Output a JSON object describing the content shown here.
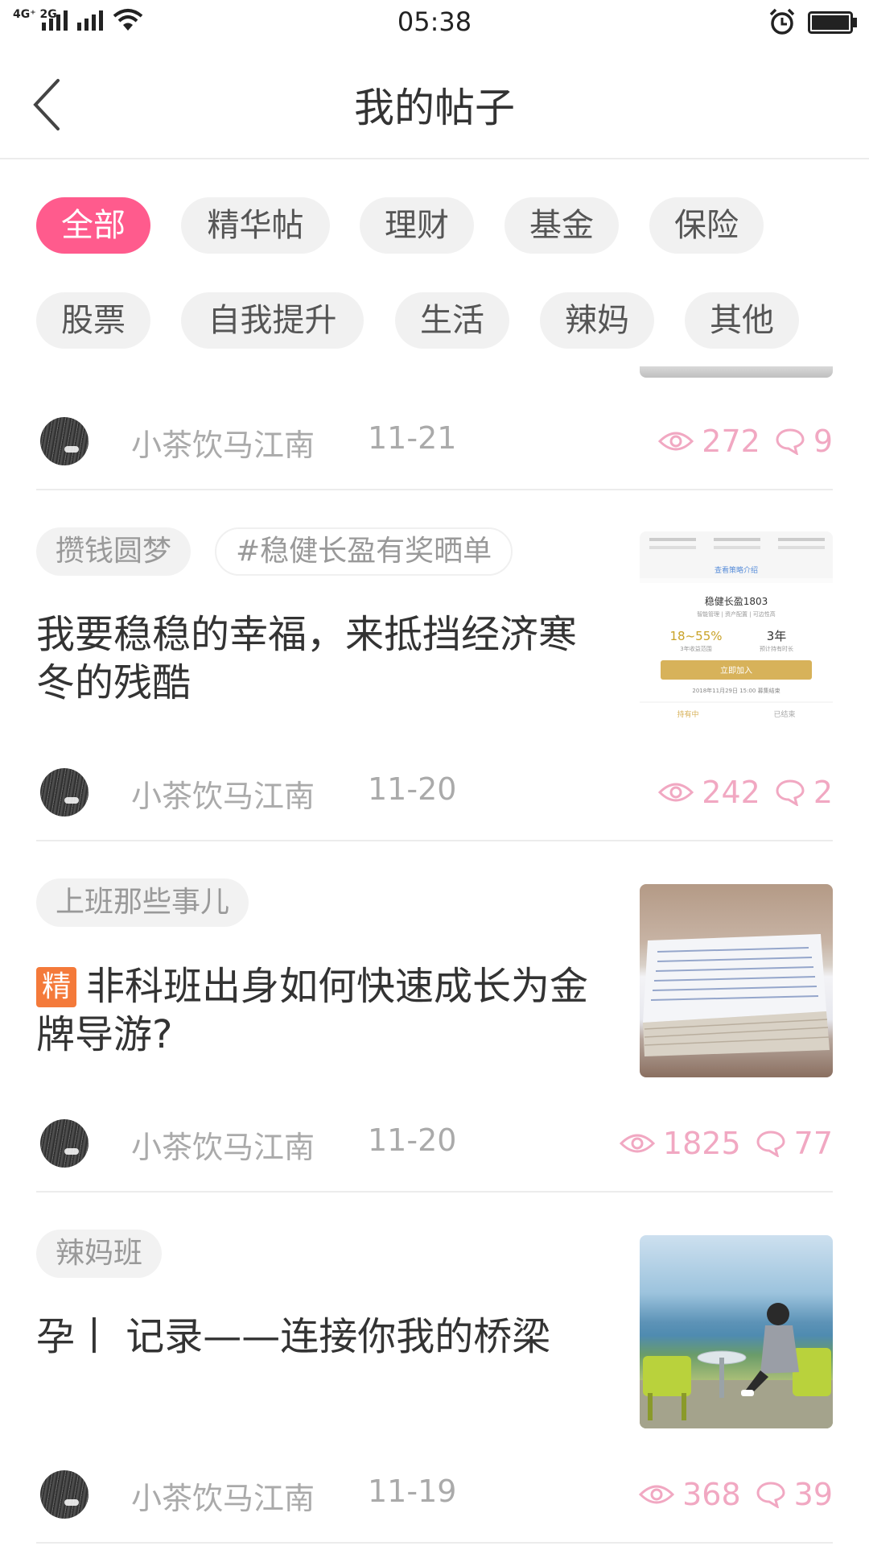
{
  "status_bar": {
    "network": "4G⁺ 2G",
    "time": "05:38"
  },
  "header": {
    "title": "我的帖子"
  },
  "filters": [
    "全部",
    "精华帖",
    "理财",
    "基金",
    "保险",
    "股票",
    "自我提升",
    "生活",
    "辣妈",
    "其他"
  ],
  "active_filter": "全部",
  "colors": {
    "accent_pink": "#ff5b8d",
    "stats_pink": "#f1a8c2",
    "featured_badge": "#f47a3a"
  },
  "posts": [
    {
      "author": "小茶饮马江南",
      "date": "11-21",
      "views": "272",
      "comments": "9"
    },
    {
      "tags": [
        "攒钱圆梦",
        "#稳健长盈有奖晒单"
      ],
      "title": "我要稳稳的幸福，来抵挡经济寒冬的残酷",
      "author": "小茶饮马江南",
      "date": "11-20",
      "views": "242",
      "comments": "2",
      "thumb": {
        "product": "稳健长盈1803",
        "product_sub": "智能管理 | 资产配置 | 可边性高",
        "rate": "18~55%",
        "rate_label": "3年收益范围",
        "term": "3年",
        "term_label": "预计持有时长",
        "button": "立即加入",
        "deadline": "2018年11月29日 15:00 募集结束",
        "tab_holding": "持有中",
        "tab_ended": "已结束",
        "more": "查看策略介绍"
      }
    },
    {
      "tags": [
        "上班那些事儿"
      ],
      "badge": "精",
      "title": "非科班出身如何快速成长为金牌导游?",
      "author": "小茶饮马江南",
      "date": "11-20",
      "views": "1825",
      "comments": "77"
    },
    {
      "tags": [
        "辣妈班"
      ],
      "title": "孕丨 记录——连接你我的桥梁",
      "author": "小茶饮马江南",
      "date": "11-19",
      "views": "368",
      "comments": "39"
    }
  ]
}
